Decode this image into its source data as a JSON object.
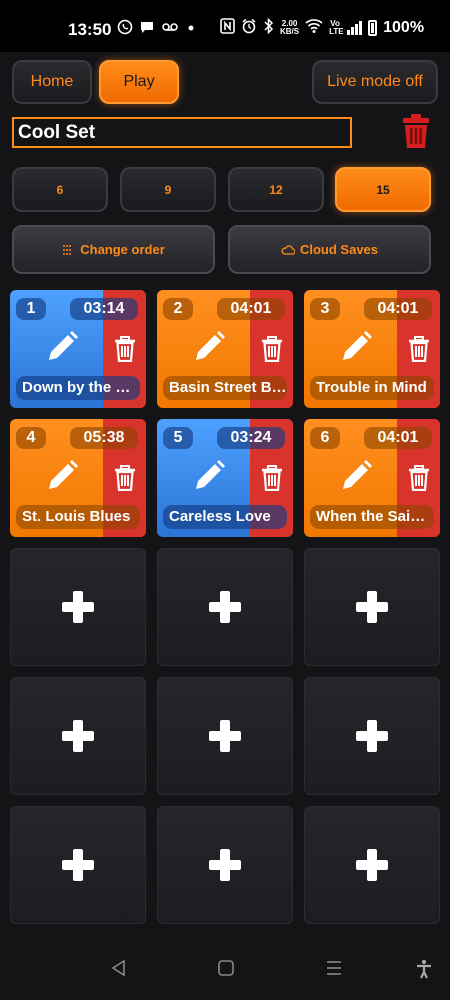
{
  "status_bar": {
    "time": "13:50",
    "left_icons": [
      "whatsapp-icon",
      "chat-icon",
      "voicemail-icon",
      "dot-icon"
    ],
    "right_icons": [
      "nfc-icon",
      "alarm-icon",
      "bluetooth-icon",
      "data-speed",
      "wifi-icon",
      "volte-icon",
      "signal-icon",
      "battery-icon"
    ],
    "data_speed_value": "2.00",
    "data_speed_unit": "KB/S",
    "volte_label": "Vo LTE",
    "battery": "100%"
  },
  "top_nav": {
    "home_label": "Home",
    "play_label": "Play",
    "live_mode_label": "Live mode off"
  },
  "set": {
    "name": "Cool Set"
  },
  "grid_size_options": [
    "6",
    "9",
    "12",
    "15"
  ],
  "grid_size_selected": "15",
  "actions": {
    "change_order_label": "Change order",
    "cloud_saves_label": "Cloud Saves"
  },
  "pads": [
    {
      "number": "1",
      "time": "03:14",
      "title": "Down by the R…",
      "color": "blue"
    },
    {
      "number": "2",
      "time": "04:01",
      "title": "Basin Street B…",
      "color": "orange"
    },
    {
      "number": "3",
      "time": "04:01",
      "title": "Trouble in Mind",
      "color": "orange"
    },
    {
      "number": "4",
      "time": "05:38",
      "title": "St. Louis Blues",
      "color": "orange"
    },
    {
      "number": "5",
      "time": "03:24",
      "title": "Careless Love",
      "color": "blue"
    },
    {
      "number": "6",
      "time": "04:01",
      "title": "When the Sain…",
      "color": "orange"
    }
  ],
  "empty_pad_count": 9,
  "colors": {
    "accent": "#ff8c1a",
    "pad_blue": "#3d8ef0",
    "pad_orange": "#f57f00",
    "delete_red": "#d9342b",
    "background": "#141417"
  },
  "nav_bar": {
    "icons": [
      "back-icon",
      "home-icon",
      "recents-icon",
      "accessibility-icon"
    ]
  }
}
